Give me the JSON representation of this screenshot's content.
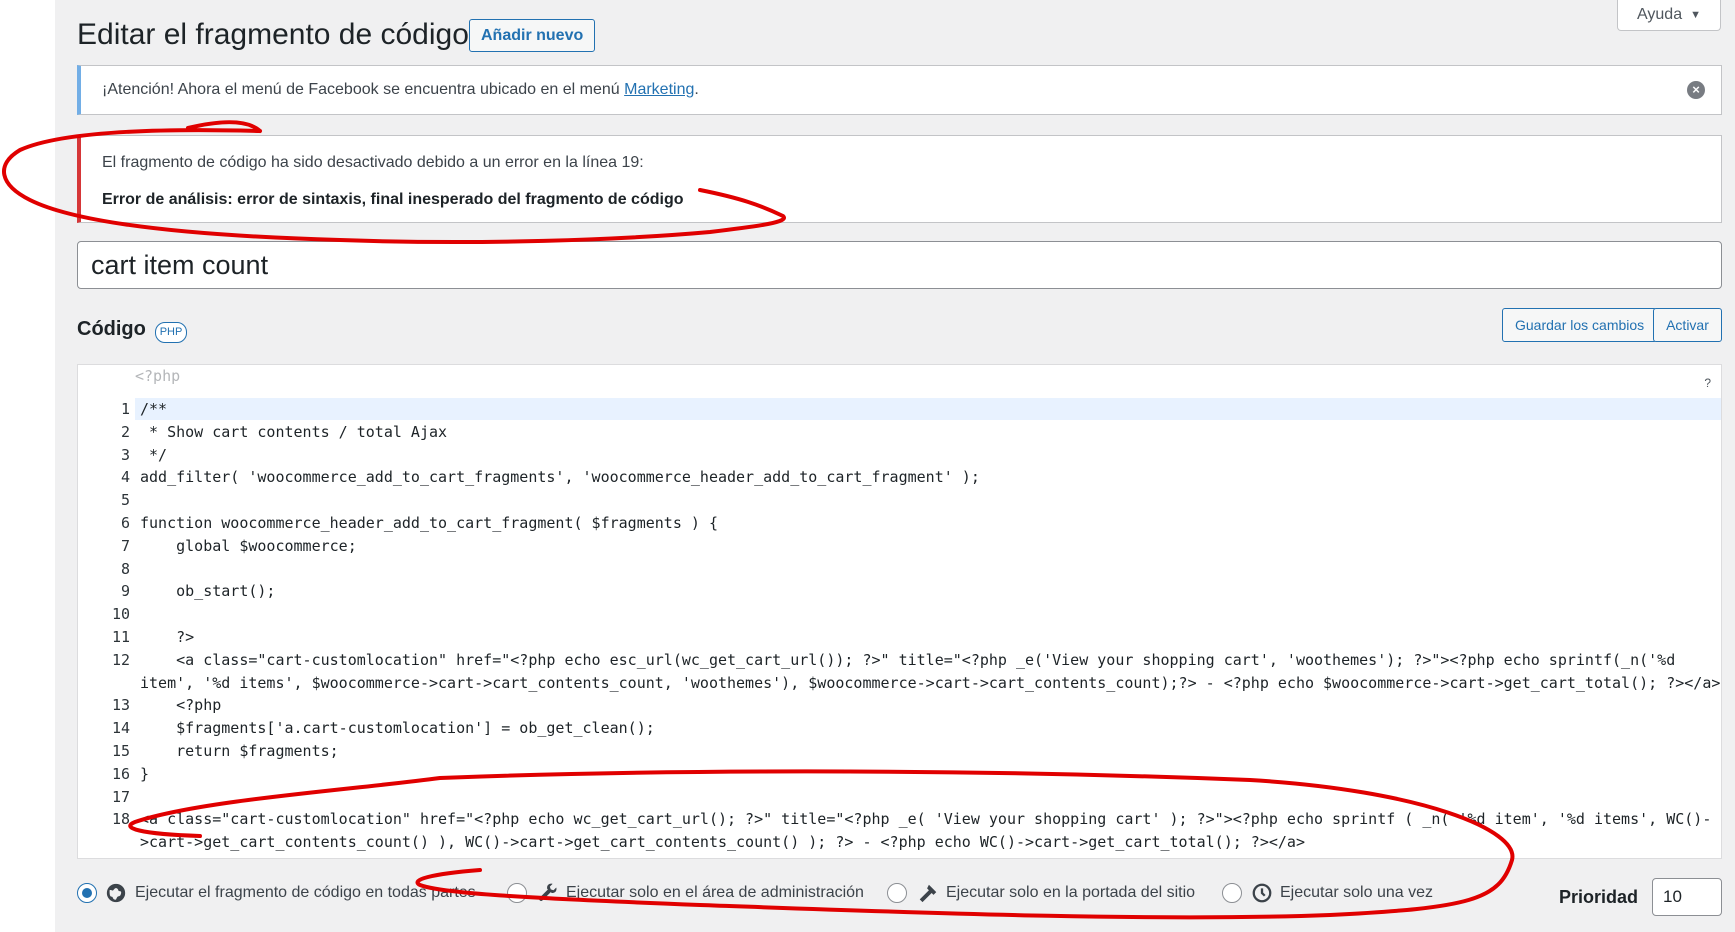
{
  "header": {
    "title": "Editar el fragmento de código",
    "add_new_label": "Añadir nuevo",
    "help_label": "Ayuda"
  },
  "notices": {
    "info_text": "¡Atención! Ahora el menú de Facebook se encuentra ubicado en el menú",
    "info_link": "Marketing",
    "info_suffix": ".",
    "error_line1": "El fragmento de código ha sido desactivado debido a un error en la línea 19:",
    "error_line2": "Error de análisis: error de sintaxis, final inesperado del fragmento de código"
  },
  "snippet": {
    "title_value": "cart item count",
    "code_heading": "Código",
    "lang_badge": "PHP",
    "save_label": "Guardar los cambios",
    "activate_label": "Activar",
    "php_open_tag": "<?php",
    "help_mark": "?"
  },
  "code_lines": [
    {
      "n": "1",
      "text": "/**"
    },
    {
      "n": "2",
      "text": " * Show cart contents / total Ajax"
    },
    {
      "n": "3",
      "text": " */"
    },
    {
      "n": "4",
      "text": "add_filter( 'woocommerce_add_to_cart_fragments', 'woocommerce_header_add_to_cart_fragment' );"
    },
    {
      "n": "5",
      "text": ""
    },
    {
      "n": "6",
      "text": "function woocommerce_header_add_to_cart_fragment( $fragments ) {"
    },
    {
      "n": "7",
      "text": "    global $woocommerce;"
    },
    {
      "n": "8",
      "text": ""
    },
    {
      "n": "9",
      "text": "    ob_start();"
    },
    {
      "n": "10",
      "text": ""
    },
    {
      "n": "11",
      "text": "    ?>"
    },
    {
      "n": "12",
      "text": "    <a class=\"cart-customlocation\" href=\"<?php echo esc_url(wc_get_cart_url()); ?>\" title=\"<?php _e('View your shopping cart', 'woothemes'); ?>\"><?php echo sprintf(_n('%d"
    },
    {
      "n": "",
      "text": "item', '%d items', $woocommerce->cart->cart_contents_count, 'woothemes'), $woocommerce->cart->cart_contents_count);?> - <?php echo $woocommerce->cart->get_cart_total(); ?></a>"
    },
    {
      "n": "13",
      "text": "    <?php"
    },
    {
      "n": "14",
      "text": "    $fragments['a.cart-customlocation'] = ob_get_clean();"
    },
    {
      "n": "15",
      "text": "    return $fragments;"
    },
    {
      "n": "16",
      "text": "}"
    },
    {
      "n": "17",
      "text": ""
    },
    {
      "n": "18",
      "text": "<a class=\"cart-customlocation\" href=\"<?php echo wc_get_cart_url(); ?>\" title=\"<?php _e( 'View your shopping cart' ); ?>\"><?php echo sprintf ( _n( '%d item', '%d items', WC()-"
    },
    {
      "n": "",
      "text": ">cart->get_cart_contents_count() ), WC()->cart->get_cart_contents_count() ); ?> - <?php echo WC()->cart->get_cart_total(); ?></a>"
    }
  ],
  "run_options": {
    "everywhere": "Ejecutar el fragmento de código en todas partes",
    "admin": "Ejecutar solo en el área de administración",
    "frontend": "Ejecutar solo en la portada del sitio",
    "once": "Ejecutar solo una vez",
    "selected": "everywhere"
  },
  "priority": {
    "label": "Prioridad",
    "value": "10"
  },
  "colors": {
    "accent": "#2271b1",
    "error": "#d63638",
    "info": "#72aee6",
    "annotation": "#e00000"
  }
}
